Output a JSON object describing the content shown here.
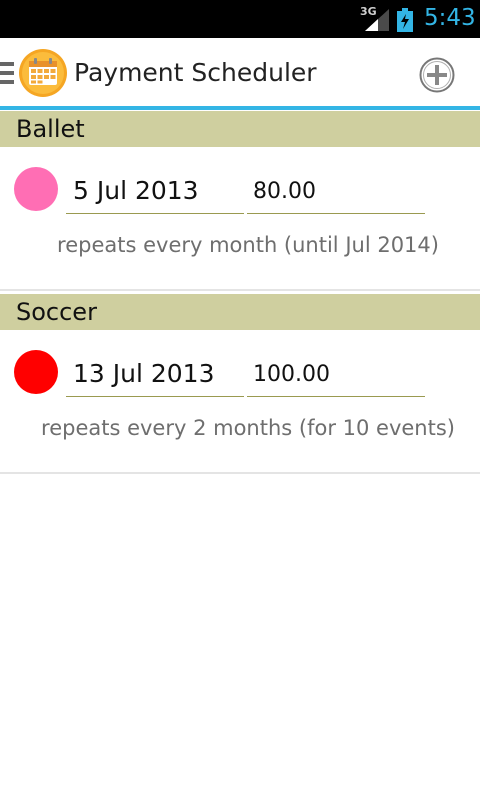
{
  "status_bar": {
    "network": "3G",
    "time": "5:43",
    "time_color": "#33b5e5"
  },
  "action_bar": {
    "title": "Payment Scheduler",
    "menu_icon": "hamburger-icon",
    "app_icon": "calendar-icon",
    "add_icon": "add-circle-icon",
    "accent_color": "#33b5e5"
  },
  "groups": [
    {
      "name": "Ballet",
      "payments": [
        {
          "date": "5 Jul 2013",
          "amount": "80.00",
          "repeat": "repeats every month (until Jul 2014)",
          "color": "#ff6eb4"
        }
      ]
    },
    {
      "name": "Soccer",
      "payments": [
        {
          "date": "13 Jul 2013",
          "amount": "100.00",
          "repeat": "repeats every 2 months (for 10 events)",
          "color": "#ff0000"
        }
      ]
    }
  ],
  "colors": {
    "group_header": "#cfcf9f",
    "field_underline": "#9a9a50"
  }
}
